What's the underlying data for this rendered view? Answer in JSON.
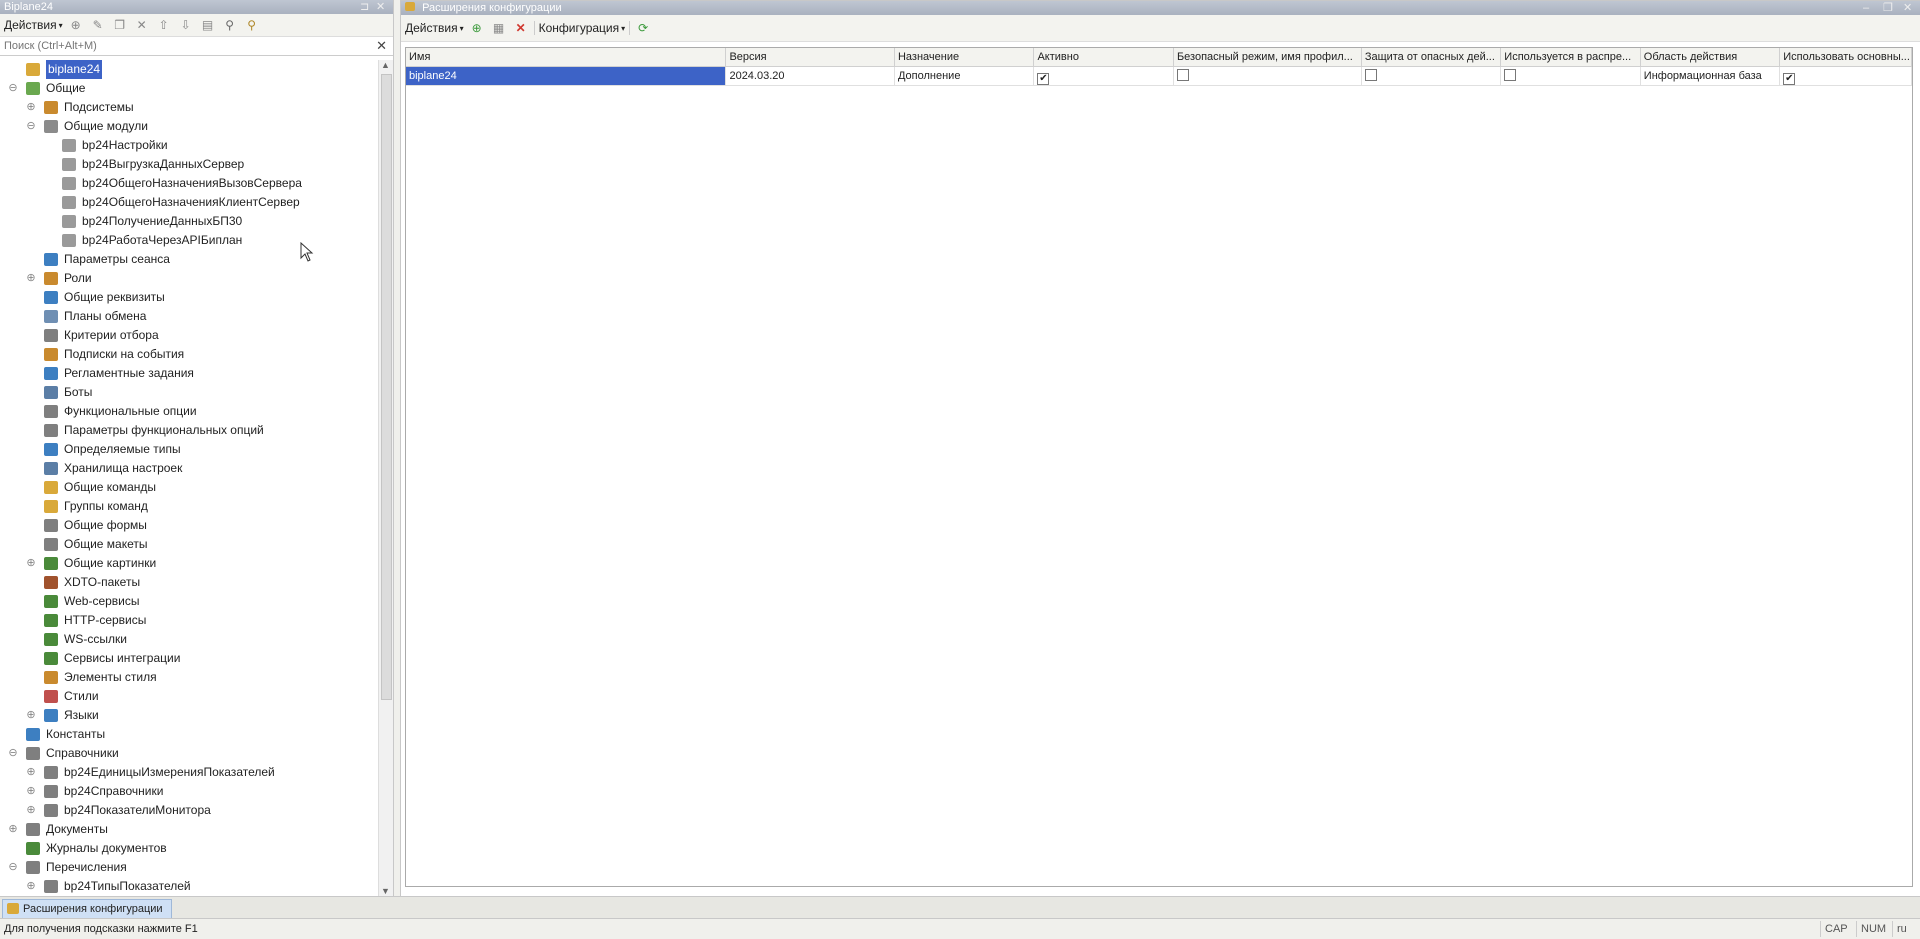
{
  "left_panel": {
    "title": "Biplane24",
    "toolbar": {
      "actions_label": "Действия"
    },
    "search": {
      "placeholder": "Поиск (Ctrl+Alt+M)"
    },
    "tree": [
      {
        "label": "biplane24",
        "level": 0,
        "exp": "",
        "icon": "config-icon",
        "color": "#d9a93a",
        "selected": true
      },
      {
        "label": "Общие",
        "level": 0,
        "exp": "⊖",
        "icon": "common-icon",
        "color": "#6aa84f"
      },
      {
        "label": "Подсистемы",
        "level": 1,
        "exp": "⊕",
        "icon": "subsystems-icon",
        "color": "#c98a2e"
      },
      {
        "label": "Общие модули",
        "level": 1,
        "exp": "⊖",
        "icon": "module-icon",
        "color": "#8b8b8b"
      },
      {
        "label": "bp24Настройки",
        "level": 2,
        "exp": "",
        "icon": "module-icon",
        "color": "#9a9a9a"
      },
      {
        "label": "bp24ВыгрузкаДанныхСервер",
        "level": 2,
        "exp": "",
        "icon": "module-icon",
        "color": "#9a9a9a"
      },
      {
        "label": "bp24ОбщегоНазначенияВызовСервера",
        "level": 2,
        "exp": "",
        "icon": "module-icon",
        "color": "#9a9a9a"
      },
      {
        "label": "bp24ОбщегоНазначенияКлиентСервер",
        "level": 2,
        "exp": "",
        "icon": "module-icon",
        "color": "#9a9a9a"
      },
      {
        "label": "bp24ПолучениеДанныхБП30",
        "level": 2,
        "exp": "",
        "icon": "module-icon",
        "color": "#9a9a9a"
      },
      {
        "label": "bp24РаботаЧерезAPIБиплан",
        "level": 2,
        "exp": "",
        "icon": "module-icon",
        "color": "#9a9a9a"
      },
      {
        "label": "Параметры сеанса",
        "level": 1,
        "exp": "",
        "icon": "session-params-icon",
        "color": "#3d7fc1"
      },
      {
        "label": "Роли",
        "level": 1,
        "exp": "⊕",
        "icon": "roles-icon",
        "color": "#c98a2e"
      },
      {
        "label": "Общие реквизиты",
        "level": 1,
        "exp": "",
        "icon": "attributes-icon",
        "color": "#3d7fc1"
      },
      {
        "label": "Планы обмена",
        "level": 1,
        "exp": "",
        "icon": "exchange-plans-icon",
        "color": "#6f8fb3"
      },
      {
        "label": "Критерии отбора",
        "level": 1,
        "exp": "",
        "icon": "filter-criteria-icon",
        "color": "#7f7f7f"
      },
      {
        "label": "Подписки на события",
        "level": 1,
        "exp": "",
        "icon": "event-subscriptions-icon",
        "color": "#c98a2e"
      },
      {
        "label": "Регламентные задания",
        "level": 1,
        "exp": "",
        "icon": "scheduled-jobs-icon",
        "color": "#3d7fc1"
      },
      {
        "label": "Боты",
        "level": 1,
        "exp": "",
        "icon": "bots-icon",
        "color": "#5b7ea6"
      },
      {
        "label": "Функциональные опции",
        "level": 1,
        "exp": "",
        "icon": "functional-options-icon",
        "color": "#7f7f7f"
      },
      {
        "label": "Параметры функциональных опций",
        "level": 1,
        "exp": "",
        "icon": "fo-params-icon",
        "color": "#7f7f7f"
      },
      {
        "label": "Определяемые типы",
        "level": 1,
        "exp": "",
        "icon": "defined-types-icon",
        "color": "#3d7fc1"
      },
      {
        "label": "Хранилища настроек",
        "level": 1,
        "exp": "",
        "icon": "settings-storage-icon",
        "color": "#5b7ea6"
      },
      {
        "label": "Общие команды",
        "level": 1,
        "exp": "",
        "icon": "common-commands-icon",
        "color": "#d9a93a"
      },
      {
        "label": "Группы команд",
        "level": 1,
        "exp": "",
        "icon": "command-groups-icon",
        "color": "#d9a93a"
      },
      {
        "label": "Общие формы",
        "level": 1,
        "exp": "",
        "icon": "common-forms-icon",
        "color": "#7f7f7f"
      },
      {
        "label": "Общие макеты",
        "level": 1,
        "exp": "",
        "icon": "common-templates-icon",
        "color": "#7f7f7f"
      },
      {
        "label": "Общие картинки",
        "level": 1,
        "exp": "⊕",
        "icon": "common-pictures-icon",
        "color": "#4a8a3a"
      },
      {
        "label": "XDTO-пакеты",
        "level": 1,
        "exp": "",
        "icon": "xdto-icon",
        "color": "#a0522d"
      },
      {
        "label": "Web-сервисы",
        "level": 1,
        "exp": "",
        "icon": "web-services-icon",
        "color": "#4a8a3a"
      },
      {
        "label": "HTTP-сервисы",
        "level": 1,
        "exp": "",
        "icon": "http-services-icon",
        "color": "#4a8a3a"
      },
      {
        "label": "WS-ссылки",
        "level": 1,
        "exp": "",
        "icon": "ws-links-icon",
        "color": "#4a8a3a"
      },
      {
        "label": "Сервисы интеграции",
        "level": 1,
        "exp": "",
        "icon": "integration-services-icon",
        "color": "#4a8a3a"
      },
      {
        "label": "Элементы стиля",
        "level": 1,
        "exp": "",
        "icon": "style-items-icon",
        "color": "#c98a2e"
      },
      {
        "label": "Стили",
        "level": 1,
        "exp": "",
        "icon": "styles-icon",
        "color": "#c0504d"
      },
      {
        "label": "Языки",
        "level": 1,
        "exp": "⊕",
        "icon": "languages-icon",
        "color": "#3d7fc1"
      },
      {
        "label": "Константы",
        "level": 0,
        "exp": "",
        "icon": "constants-icon",
        "color": "#3d7fc1"
      },
      {
        "label": "Справочники",
        "level": 0,
        "exp": "⊖",
        "icon": "catalogs-icon",
        "color": "#7f7f7f"
      },
      {
        "label": "bp24ЕдиницыИзмеренияПоказателей",
        "level": 1,
        "exp": "⊕",
        "icon": "catalog-icon",
        "color": "#7f7f7f"
      },
      {
        "label": "bp24Справочники",
        "level": 1,
        "exp": "⊕",
        "icon": "catalog-icon",
        "color": "#7f7f7f"
      },
      {
        "label": "bp24ПоказателиМонитора",
        "level": 1,
        "exp": "⊕",
        "icon": "catalog-icon",
        "color": "#7f7f7f"
      },
      {
        "label": "Документы",
        "level": 0,
        "exp": "⊕",
        "icon": "documents-icon",
        "color": "#7f7f7f"
      },
      {
        "label": "Журналы документов",
        "level": 0,
        "exp": "",
        "icon": "document-journals-icon",
        "color": "#4a8a3a"
      },
      {
        "label": "Перечисления",
        "level": 0,
        "exp": "⊖",
        "icon": "enums-icon",
        "color": "#7f7f7f"
      },
      {
        "label": "bp24ТипыПоказателей",
        "level": 1,
        "exp": "⊕",
        "icon": "enum-icon",
        "color": "#7f7f7f"
      }
    ]
  },
  "main": {
    "title": "Расширения конфигурации",
    "toolbar": {
      "actions_label": "Действия",
      "config_label": "Конфигурация"
    },
    "columns": [
      "Имя",
      "Версия",
      "Назначение",
      "Активно",
      "Безопасный режим, имя профил...",
      "Защита от опасных дей...",
      "Используется в распре...",
      "Область действия",
      "Использовать основны..."
    ],
    "rows": [
      {
        "name": "biplane24",
        "version": "2024.03.20",
        "purpose": "Дополнение",
        "active": true,
        "safe_mode": false,
        "protection": false,
        "used_in_dist": false,
        "scope": "Информационная база",
        "use_main": true
      }
    ]
  },
  "taskbar": {
    "open_window": "Расширения конфигурации"
  },
  "status": {
    "hint": "Для получения подсказки нажмите F1",
    "cap": "CAP",
    "num": "NUM",
    "lang": "ru"
  }
}
